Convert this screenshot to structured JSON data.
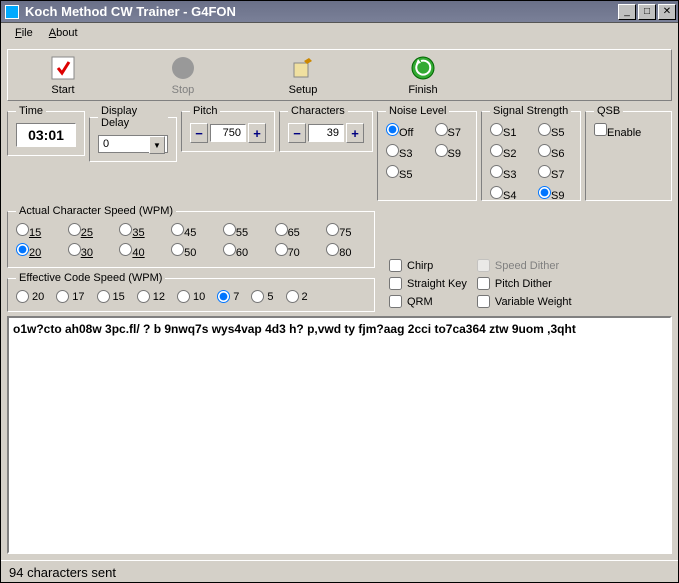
{
  "window": {
    "title": "Koch Method CW Trainer - G4FON"
  },
  "menu": {
    "file": "File",
    "about": "About"
  },
  "toolbar": {
    "start": "Start",
    "stop": "Stop",
    "setup": "Setup",
    "finish": "Finish"
  },
  "time": {
    "legend": "Time",
    "value": "03:01"
  },
  "displayDelay": {
    "legend": "Display Delay",
    "value": "0"
  },
  "pitch": {
    "legend": "Pitch",
    "value": "750"
  },
  "characters": {
    "legend": "Characters",
    "value": "39"
  },
  "actualSpeed": {
    "legend": "Actual Character Speed (WPM)",
    "options": [
      "15",
      "20",
      "25",
      "30",
      "35",
      "40",
      "45",
      "50",
      "55",
      "60",
      "65",
      "70",
      "75",
      "80"
    ],
    "selected": "20"
  },
  "effectiveSpeed": {
    "legend": "Effective Code Speed (WPM)",
    "options": [
      "20",
      "17",
      "15",
      "12",
      "10",
      "7",
      "5",
      "2"
    ],
    "selected": "7"
  },
  "noise": {
    "legend": "Noise Level",
    "options": [
      "Off",
      "S3",
      "S5",
      "S7",
      "S9"
    ],
    "selected": "Off"
  },
  "signal": {
    "legend": "Signal Strength",
    "options": [
      "S1",
      "S2",
      "S3",
      "S4",
      "S5",
      "S6",
      "S7",
      "S9"
    ],
    "selected": "S9"
  },
  "qsb": {
    "legend": "QSB",
    "enable": "Enable"
  },
  "checks1": {
    "chirp": "Chirp",
    "straight": "Straight Key",
    "qrm": "QRM"
  },
  "checks2": {
    "speedDither": "Speed Dither",
    "pitchDither": "Pitch Dither",
    "varWeight": "Variable Weight"
  },
  "output": "o1w?cto ah08w 3pc.fl/ ? b 9nwq7s wys4vap 4d3 h? p,vwd ty fjm?aag 2cci to7ca364 ztw 9uom ,3qht",
  "status": "94 characters sent"
}
